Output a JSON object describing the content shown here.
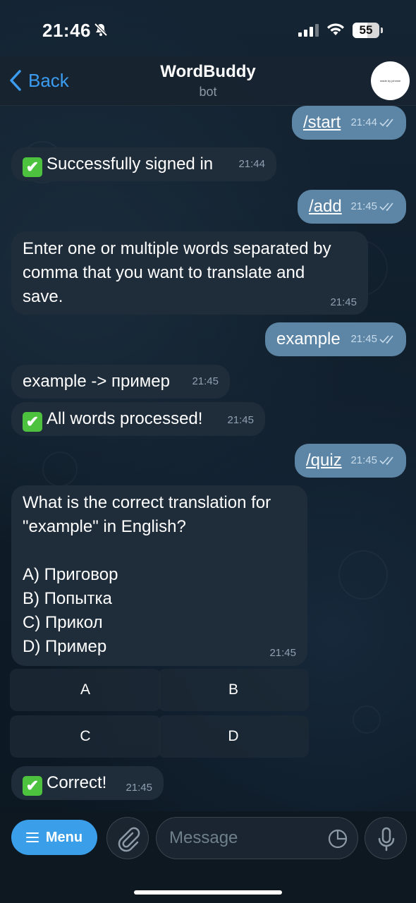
{
  "status_bar": {
    "time": "21:46",
    "battery": "55",
    "battery_level": 0.55
  },
  "header": {
    "back_label": "Back",
    "title": "WordBuddy",
    "subtitle": "bot",
    "avatar_text": "made by johnnie"
  },
  "messages": [
    {
      "dir": "out",
      "text": "/start",
      "time": "21:44"
    },
    {
      "dir": "in",
      "emoji": "✔",
      "text": "Successfully signed in",
      "time": "21:44"
    },
    {
      "dir": "out",
      "text": "/add",
      "time": "21:45"
    },
    {
      "dir": "in",
      "lines": [
        "Enter one or multiple words separated by",
        "comma that you want to translate and",
        "save."
      ],
      "time": "21:45"
    },
    {
      "dir": "out",
      "text": "example",
      "time": "21:45"
    },
    {
      "dir": "in",
      "text": "example -> пример",
      "time": "21:45"
    },
    {
      "dir": "in",
      "emoji": "✔",
      "text": "All words processed!",
      "time": "21:45"
    },
    {
      "dir": "out",
      "text": "/quiz",
      "time": "21:45"
    },
    {
      "dir": "in",
      "lines": [
        "What is the correct translation for",
        "\"example\" in English?",
        "",
        "A) Приговор",
        "B) Попытка",
        "C) Прикол",
        "D) Пример"
      ],
      "time": "21:45"
    },
    {
      "dir": "in",
      "emoji": "✔",
      "text": "Correct!",
      "time": "21:45"
    }
  ],
  "keyboard": [
    "A",
    "B",
    "C",
    "D"
  ],
  "input": {
    "menu_label": "Menu",
    "placeholder": "Message"
  }
}
